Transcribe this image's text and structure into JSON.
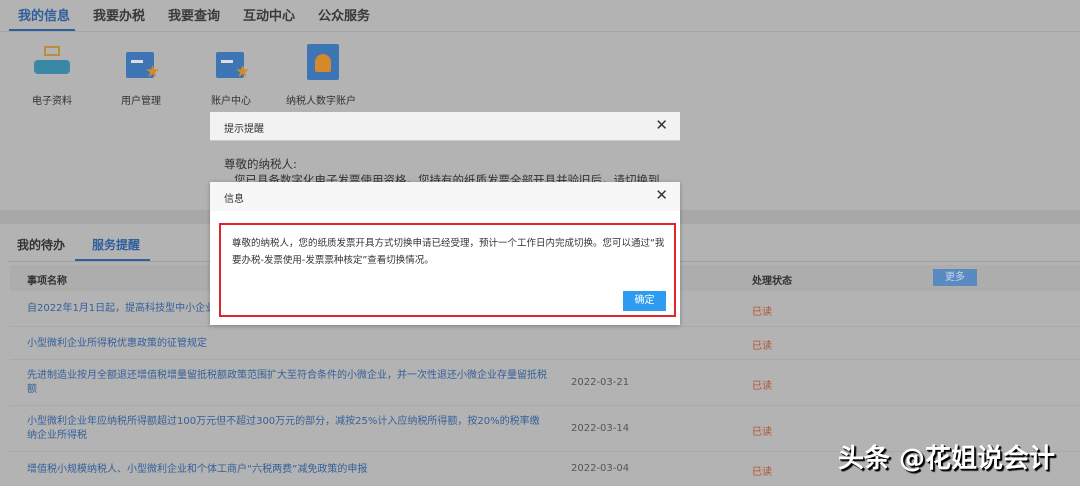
{
  "nav": {
    "tabs": [
      "我的信息",
      "我要办税",
      "我要查询",
      "互动中心",
      "公众服务"
    ]
  },
  "shortcuts": [
    {
      "label": "电子资料",
      "icon": "printer-icon"
    },
    {
      "label": "用户管理",
      "icon": "user-card-icon"
    },
    {
      "label": "账户中心",
      "icon": "account-card-icon"
    },
    {
      "label": "纳税人数字账户",
      "icon": "digital-account-icon"
    }
  ],
  "dialog_notice": {
    "title": "提示提醒",
    "greeting": "尊敬的纳税人:",
    "line": "您已具备数字化电子发票使用资格，您持有的纸质发票全部开具并验旧后，请切换到"
  },
  "dialog_info": {
    "title": "信息",
    "message": "尊敬的纳税人，您的纸质发票开具方式切换申请已经受理，预计一个工作日内完成切换。您可以通过“我要办税-发票使用-发票票种核定”查看切换情况。",
    "ok": "确定"
  },
  "lower": {
    "tabs": [
      "我的待办",
      "服务提醒"
    ],
    "col_name": "事项名称",
    "col_status": "处理状态",
    "more": "更多",
    "rows": [
      {
        "title": "自2022年1月1日起，提高科技型中小企业",
        "date": "",
        "status": "已读"
      },
      {
        "title": "小型微利企业所得税优惠政策的征管规定",
        "date": "",
        "status": "已读"
      },
      {
        "title": "先进制造业按月全额退还增值税增量留抵税额政策范围扩大至符合条件的小微企业，并一次性退还小微企业存量留抵税额",
        "date": "2022-03-21",
        "status": "已读"
      },
      {
        "title": "小型微利企业年应纳税所得额超过100万元但不超过300万元的部分，减按25%计入应纳税所得额，按20%的税率缴纳企业所得税",
        "date": "2022-03-14",
        "status": "已读"
      },
      {
        "title": "增值税小规模纳税人、小型微利企业和个体工商户“六税两费”减免政策的申报",
        "date": "2022-03-04",
        "status": "已读"
      }
    ]
  },
  "watermark": "头条 @花姐说会计"
}
